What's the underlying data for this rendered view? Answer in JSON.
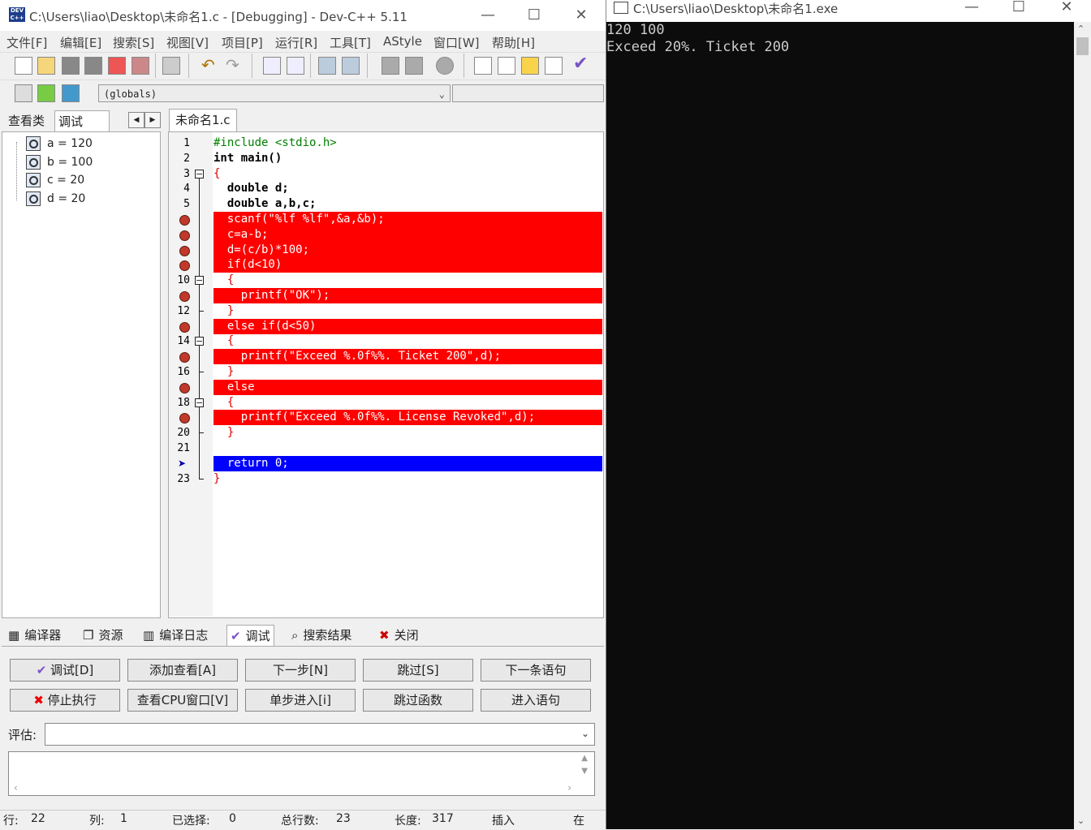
{
  "ide": {
    "title": "C:\\Users\\liao\\Desktop\\未命名1.c - [Debugging] - Dev-C++ 5.11",
    "app_icon_text": "DEV C++",
    "menu": [
      "文件[F]",
      "编辑[E]",
      "搜索[S]",
      "视图[V]",
      "项目[P]",
      "运行[R]",
      "工具[T]",
      "AStyle",
      "窗口[W]",
      "帮助[H]"
    ],
    "scope_select": "(globals)",
    "left_tabs": [
      "查看类",
      "调试"
    ],
    "watches": [
      "a = 120",
      "b = 100",
      "c = 20",
      "d = 20"
    ],
    "editor_tab": "未命名1.c",
    "code_lines": [
      "#include <stdio.h>",
      "int main()",
      "{",
      "  double d;",
      "  double a,b,c;",
      "  scanf(\"%lf %lf\",&a,&b);",
      "  c=a-b;",
      "  d=(c/b)*100;",
      "  if(d<10)",
      "  {",
      "    printf(\"OK\");",
      "  }",
      "  else if(d<50)",
      "  {",
      "    printf(\"Exceed %.0f%%. Ticket 200\",d);",
      "  }",
      "  else",
      "  {",
      "    printf(\"Exceed %.0f%%. License Revoked\",d);",
      "  }",
      "",
      "  return 0;",
      "}"
    ],
    "line_numbers": [
      "1",
      "2",
      "3",
      "4",
      "5",
      "",
      "",
      "",
      "",
      "10",
      "",
      "12",
      "",
      "14",
      "",
      "16",
      "",
      "18",
      "",
      "20",
      "21",
      "",
      "23"
    ],
    "bottom_tabs": [
      "编译器",
      "资源",
      "编译日志",
      "调试",
      "搜索结果",
      "关闭"
    ],
    "debug_buttons": {
      "debug": "调试[D]",
      "add_watch": "添加查看[A]",
      "next_step": "下一步[N]",
      "skip": "跳过[S]",
      "next_statement": "下一条语句",
      "stop": "停止执行",
      "cpu_window": "查看CPU窗口[V]",
      "step_into": "单步进入[i]",
      "skip_function": "跳过函数",
      "into_statement": "进入语句"
    },
    "eval_label": "评估:",
    "status": {
      "row_label": "行:",
      "row": "22",
      "col_label": "列:",
      "col": "1",
      "sel_label": "已选择:",
      "sel": "0",
      "total_label": "总行数:",
      "total": "23",
      "len_label": "长度:",
      "len": "317",
      "insert": "插入",
      "at": "在"
    }
  },
  "console": {
    "title": "C:\\Users\\liao\\Desktop\\未命名1.exe",
    "lines": [
      "120 100",
      "Exceed 20%. Ticket 200"
    ]
  },
  "colors": {
    "breakpoint": "#ff0000",
    "current_line": "#0000ff",
    "console_bg": "#0c0c0c"
  }
}
